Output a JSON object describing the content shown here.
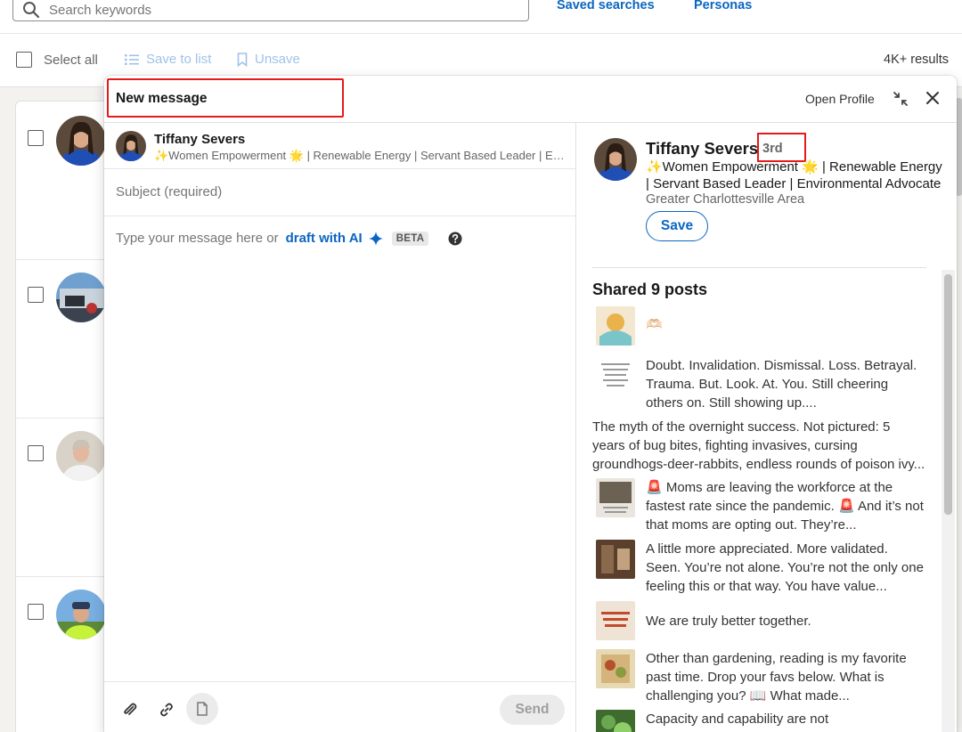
{
  "search": {
    "placeholder": "Search keywords"
  },
  "top_links": {
    "saved_searches": "Saved searches",
    "personas": "Personas"
  },
  "action_bar": {
    "select_all": "Select all",
    "save_to_list": "Save to list",
    "unsave": "Unsave",
    "results": "4K+ results"
  },
  "modal": {
    "title": "New message",
    "open_profile": "Open Profile",
    "recipient": {
      "name": "Tiffany Severs",
      "headline": "✨Women Empowerment 🌟 | Renewable Energy | Servant Based Leader | Environmental Advocate"
    },
    "subject_placeholder": "Subject (required)",
    "message_placeholder": "Type your message here or",
    "draft_ai": "draft with AI",
    "beta": "BETA",
    "send": "Send"
  },
  "profile": {
    "name": "Tiffany Severs",
    "degree": "3rd",
    "headline": "✨Women Empowerment 🌟 | Renewable Energy | Servant Based Leader | Environmental Advocate",
    "location": "Greater Charlottesville Area",
    "save": "Save",
    "shared_title": "Shared 9 posts",
    "posts": [
      {
        "text": "🫶🏻"
      },
      {
        "text": "Doubt. Invalidation. Dismissal. Loss. Betrayal. Trauma. But. Look. At. You. Still cheering others on. Still showing up...."
      },
      {
        "text": "The myth of the overnight success. Not pictured: 5 years of bug bites, fighting invasives, cursing groundhogs-deer-rabbits, endless rounds of poison ivy..."
      },
      {
        "text": "🚨 Moms are leaving the workforce at the fastest rate since the pandemic. 🚨 And it’s not that moms are opting out. They’re..."
      },
      {
        "text": "A little more appreciated. More validated. Seen. You’re not alone. You’re not the only one feeling this or that way. You have value..."
      },
      {
        "text": "We are truly better together."
      },
      {
        "text": "Other than gardening, reading is my favorite past time. Drop your favs below. What is challenging you? 📖 What made..."
      },
      {
        "text": "Capacity and capability are not interchangeable. Saying yes to everything..."
      }
    ]
  },
  "colors": {
    "accent": "#0a66c2",
    "highlight": "#e51a1a"
  }
}
